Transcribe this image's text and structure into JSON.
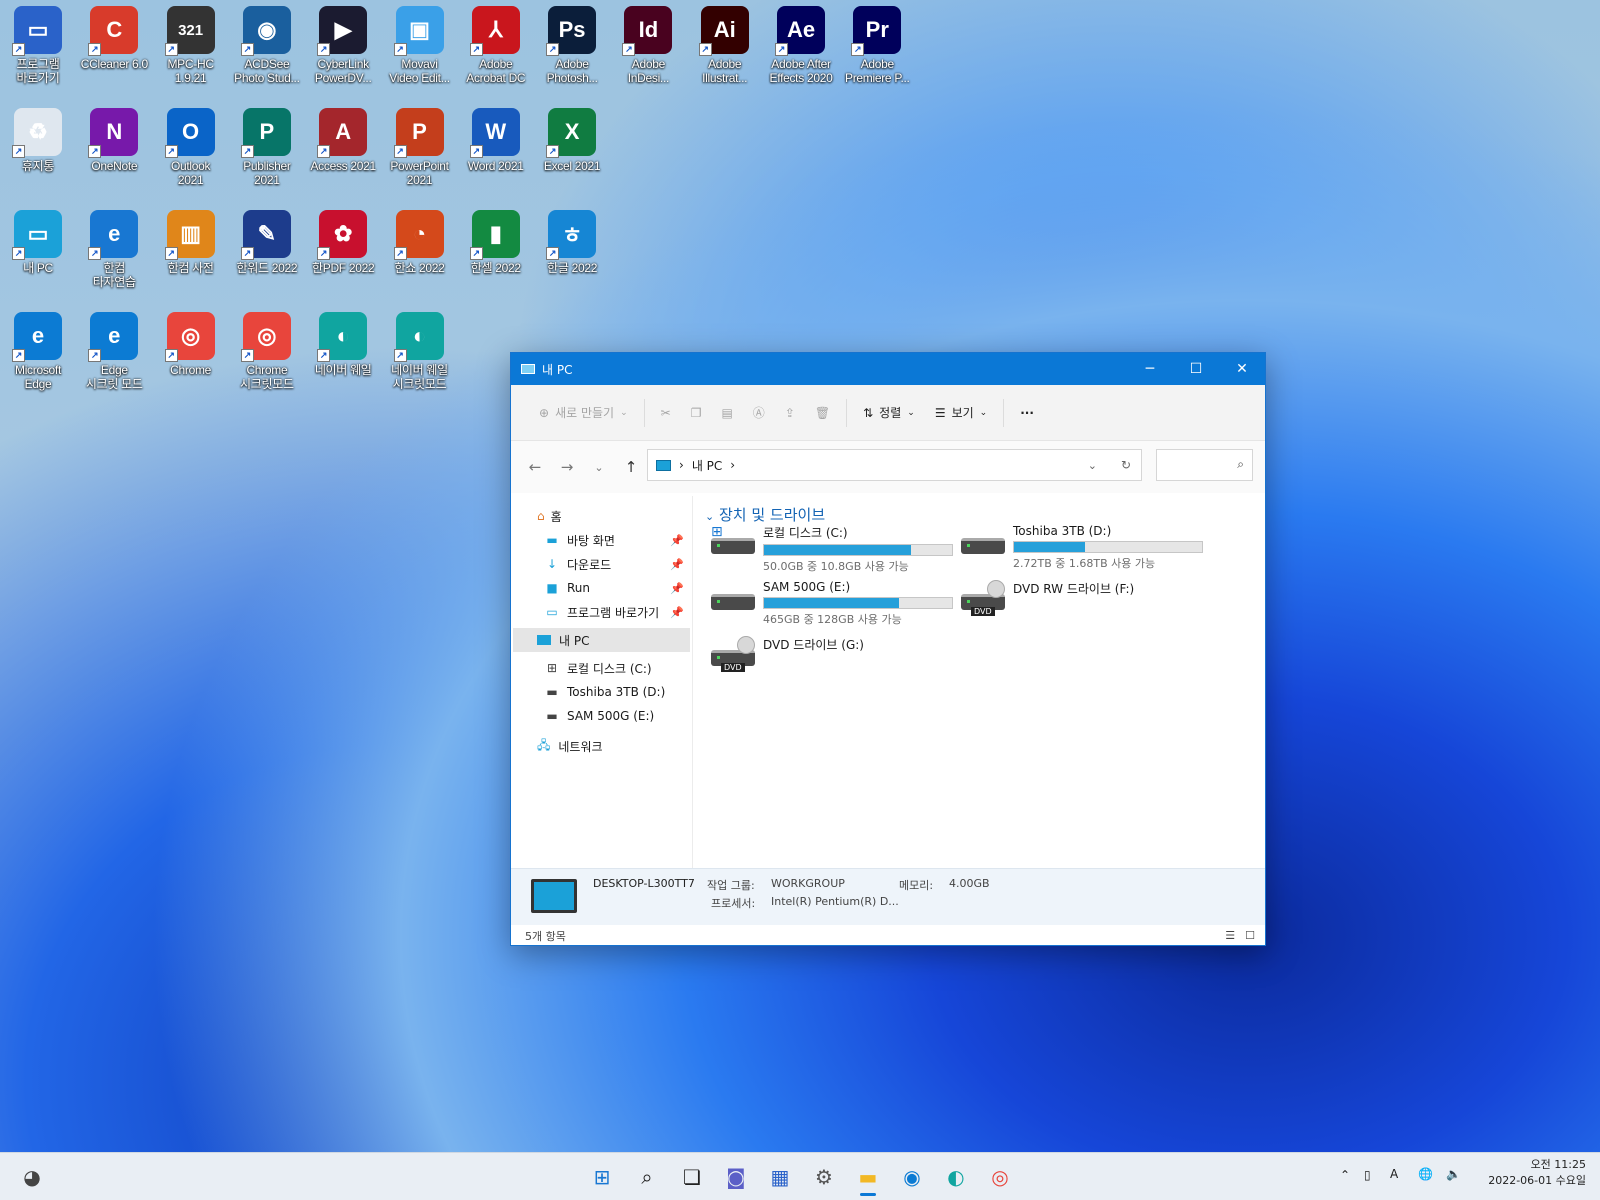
{
  "desktop": {
    "icons": [
      {
        "label": "프로그램\n바로가기",
        "glyph": "▭",
        "bg": "#2a62c9"
      },
      {
        "label": "CCleaner 6.0",
        "glyph": "C",
        "bg": "#d83b2b"
      },
      {
        "label": "MPC-HC\n1.9.21",
        "glyph": "321",
        "bg": "#333333"
      },
      {
        "label": "ACDSee\nPhoto Stud...",
        "glyph": "◉",
        "bg": "#1a5f9e"
      },
      {
        "label": "CyberLink\nPowerDV...",
        "glyph": "▶",
        "bg": "#1b1b30"
      },
      {
        "label": "Movavi\nVideo Edit...",
        "glyph": "▣",
        "bg": "#3aa0e8"
      },
      {
        "label": "Adobe\nAcrobat DC",
        "glyph": "⅄",
        "bg": "#c9161d"
      },
      {
        "label": "Adobe\nPhotosh...",
        "glyph": "Ps",
        "bg": "#0b1e3a"
      },
      {
        "label": "Adobe\nInDesi...",
        "glyph": "Id",
        "bg": "#49021f"
      },
      {
        "label": "Adobe\nIllustrat...",
        "glyph": "Ai",
        "bg": "#330000"
      },
      {
        "label": "Adobe After\nEffects 2020",
        "glyph": "Ae",
        "bg": "#00005b"
      },
      {
        "label": "Adobe\nPremiere P...",
        "glyph": "Pr",
        "bg": "#00005b"
      },
      {
        "label": "휴지통",
        "glyph": "♻",
        "bg": "#dfe7ef"
      },
      {
        "label": "OneNote",
        "glyph": "N",
        "bg": "#7719aa"
      },
      {
        "label": "Outlook\n2021",
        "glyph": "O",
        "bg": "#0a64c8"
      },
      {
        "label": "Publisher\n2021",
        "glyph": "P",
        "bg": "#077568"
      },
      {
        "label": "Access 2021",
        "glyph": "A",
        "bg": "#a4262c"
      },
      {
        "label": "PowerPoint\n2021",
        "glyph": "P",
        "bg": "#c43e1c"
      },
      {
        "label": "Word 2021",
        "glyph": "W",
        "bg": "#185abd"
      },
      {
        "label": "Excel 2021",
        "glyph": "X",
        "bg": "#107c41"
      },
      {
        "label": "내 PC",
        "glyph": "▭",
        "bg": "#1ba1d8"
      },
      {
        "label": "한컴\n타자연습",
        "glyph": "e",
        "bg": "#1877d2"
      },
      {
        "label": "한컴 사전",
        "glyph": "▥",
        "bg": "#e0861a"
      },
      {
        "label": "한워드 2022",
        "glyph": "✎",
        "bg": "#1d3c8c"
      },
      {
        "label": "한PDF 2022",
        "glyph": "✿",
        "bg": "#c8102e"
      },
      {
        "label": "한쇼 2022",
        "glyph": "◔",
        "bg": "#d4491b"
      },
      {
        "label": "한셀 2022",
        "glyph": "▮",
        "bg": "#138a41"
      },
      {
        "label": "한글 2022",
        "glyph": "ㅎ",
        "bg": "#1686d4"
      },
      {
        "label": "Microsoft\nEdge",
        "glyph": "e",
        "bg": "#0c7bd3"
      },
      {
        "label": "Edge\n시크릿 모드",
        "glyph": "e",
        "bg": "#0c7bd3"
      },
      {
        "label": "Chrome",
        "glyph": "◎",
        "bg": "#e8453c"
      },
      {
        "label": "Chrome\n시크릿모드",
        "glyph": "◎",
        "bg": "#e8453c"
      },
      {
        "label": "네이버 웨일",
        "glyph": "◐",
        "bg": "#10a5a0"
      },
      {
        "label": "네이버 웨일\n시크릿모드",
        "glyph": "◐",
        "bg": "#10a5a0"
      }
    ]
  },
  "window": {
    "title": "내 PC",
    "controls": {
      "min": "─",
      "max": "☐",
      "close": "✕"
    },
    "toolbar": {
      "new_label": "새로 만들기",
      "sort_label": "정렬",
      "view_label": "보기",
      "more_label": "···"
    },
    "address": {
      "location": "내 PC"
    },
    "nav": {
      "home": "홈",
      "quick": [
        {
          "label": "바탕 화면",
          "icon": "▬"
        },
        {
          "label": "다운로드",
          "icon": "↓"
        },
        {
          "label": "Run",
          "icon": "■"
        },
        {
          "label": "프로그램 바로가기",
          "icon": "▭"
        }
      ],
      "this_pc": "내 PC",
      "drives": [
        {
          "label": "로컬 디스크 (C:)",
          "icon": "⊞"
        },
        {
          "label": "Toshiba 3TB (D:)",
          "icon": "▬"
        },
        {
          "label": "SAM 500G (E:)",
          "icon": "▬"
        }
      ],
      "network": "네트워크"
    },
    "group_title": "장치 및 드라이브",
    "drives": [
      {
        "name": "로컬 디스크 (C:)",
        "free": "50.0GB 중 10.8GB 사용 가능",
        "used_fraction": 0.78
      },
      {
        "name": "Toshiba 3TB (D:)",
        "free": "2.72TB 중 1.68TB 사용 가능",
        "used_fraction": 0.38
      },
      {
        "name": "SAM 500G (E:)",
        "free": "465GB 중 128GB 사용 가능",
        "used_fraction": 0.72
      },
      {
        "name": "DVD RW 드라이브 (F:)"
      },
      {
        "name": "DVD 드라이브 (G:)"
      }
    ],
    "dvd_tag": "DVD",
    "details": {
      "pc_name": "DESKTOP-L300TT7",
      "workgroup_label": "작업 그룹:",
      "workgroup": "WORKGROUP",
      "memory_label": "메모리:",
      "memory": "4.00GB",
      "processor_label": "프로세서:",
      "processor": "Intel(R) Pentium(R) D..."
    },
    "status": {
      "count": "5개 항목"
    }
  },
  "taskbar": {
    "time": "오전 11:25",
    "date": "2022-06-01 수요일",
    "ime": "A"
  }
}
